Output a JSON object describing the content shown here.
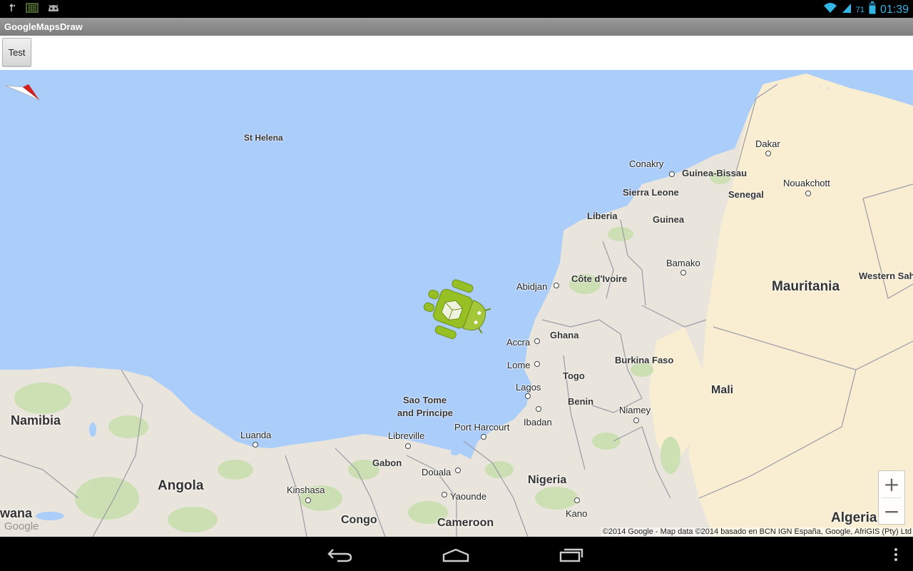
{
  "status_bar": {
    "time": "01:39",
    "battery_level": "71",
    "icons": [
      "usb-debug-icon",
      "keyboard-icon",
      "android-face-icon",
      "wifi-icon",
      "cell-signal-icon",
      "battery-icon"
    ]
  },
  "app": {
    "title": "GoogleMapsDraw"
  },
  "toolbar": {
    "test_label": "Test"
  },
  "map": {
    "cities": [
      "St Helena",
      "Dakar",
      "Conakry",
      "Nouakchott",
      "Bamako",
      "Abidjan",
      "Accra",
      "Lome",
      "Lagos",
      "Ibadan",
      "Niamey",
      "Port Harcourt",
      "Libreville",
      "Douala",
      "Yaounde",
      "Kano",
      "Luanda",
      "Kinshasa"
    ],
    "countries": [
      "Guinea-Bissau",
      "Sierra Leone",
      "Senegal",
      "Liberia",
      "Guinea",
      "Côte d'Ivoire",
      "Ghana",
      "Burkina Faso",
      "Togo",
      "Benin",
      "Gabon",
      "Sao Tome",
      "and Principe",
      "Western Saha"
    ],
    "countries_large": [
      "Mauritania",
      "Mali",
      "Nigeria",
      "Namibia",
      "Angola",
      "Congo",
      "Cameroon",
      "Algeria",
      "wana"
    ],
    "zoom_in": "+",
    "zoom_out": "−",
    "google_logo": "Google",
    "attribution": "©2014 Google - Map data ©2014 basado en BCN IGN España, Google, AfriGIS (Pty) Ltd",
    "colors": {
      "water": "#abcdfa",
      "land": "#e9e5dc",
      "desert": "#f9eed2",
      "park": "#c9dfaf"
    }
  },
  "nav_bar": {
    "icons": [
      "back-icon",
      "home-icon",
      "recents-icon",
      "menu-icon"
    ]
  }
}
